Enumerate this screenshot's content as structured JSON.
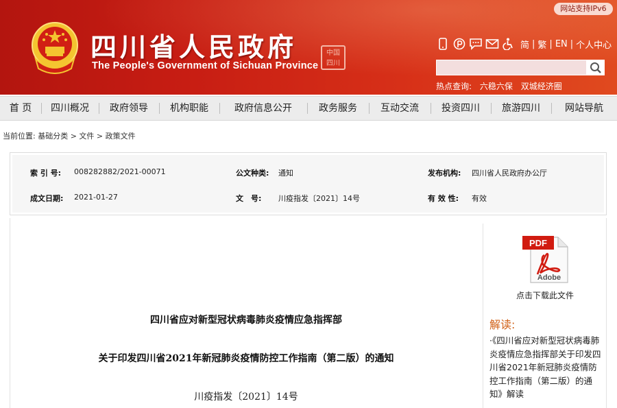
{
  "header": {
    "title_cn": "四川省人民政府",
    "title_en": "The People's Government of Sichuan Province",
    "seal_text": "中国四川",
    "ipv6_badge": "网站支持IPv6",
    "lang_simplified": "简",
    "lang_traditional": "繁",
    "lang_english": "EN",
    "personal_center": "个人中心",
    "search_placeholder": "",
    "hot_label": "热点查询:",
    "hot_links": [
      "六稳六保",
      "双城经济圈"
    ],
    "icons": [
      "mobile-icon",
      "weibo-icon",
      "message-icon",
      "mail-icon",
      "accessibility-icon",
      "search-icon"
    ]
  },
  "nav": {
    "items": [
      "首 页",
      "四川概况",
      "政府领导",
      "机构职能",
      "政府信息公开",
      "政务服务",
      "互动交流",
      "投资四川",
      "旅游四川",
      "网站导航"
    ]
  },
  "breadcrumb": "当前位置: 基础分类 > 文件 > 政策文件",
  "meta": {
    "index_label": "索 引 号:",
    "index_value": "008282882/2021-00071",
    "category_label": "公文种类:",
    "category_value": "通知",
    "publisher_label": "发布机构:",
    "publisher_value": "四川省人民政府办公厅",
    "date_label": "成文日期:",
    "date_value": "2021-01-27",
    "docno_label": "文　号:",
    "docno_value": "川疫指发〔2021〕14号",
    "validity_label": "有 效 性:",
    "validity_value": "有效"
  },
  "document": {
    "title_line1": "四川省应对新型冠状病毒肺炎疫情应急指挥部",
    "title_line2": "关于印发四川省2021年新冠肺炎疫情防控工作指南（第二版）的通知",
    "doc_number": "川疫指发〔2021〕14号"
  },
  "sidebar": {
    "pdf_label": "PDF",
    "adobe_label": "Adobe",
    "download_label": "点击下载此文件",
    "jiedu_heading": "解读:",
    "jiedu_link": "·《四川省应对新型冠状病毒肺炎疫情应急指挥部关于印发四川省2021年新冠肺炎疫情防控工作指南（第二版）的通知》解读"
  },
  "colors": {
    "header_red": "#c71d13",
    "nav_bg": "#ececec",
    "meta_bg": "#f6f6f6",
    "accent_orange": "#d16016"
  }
}
